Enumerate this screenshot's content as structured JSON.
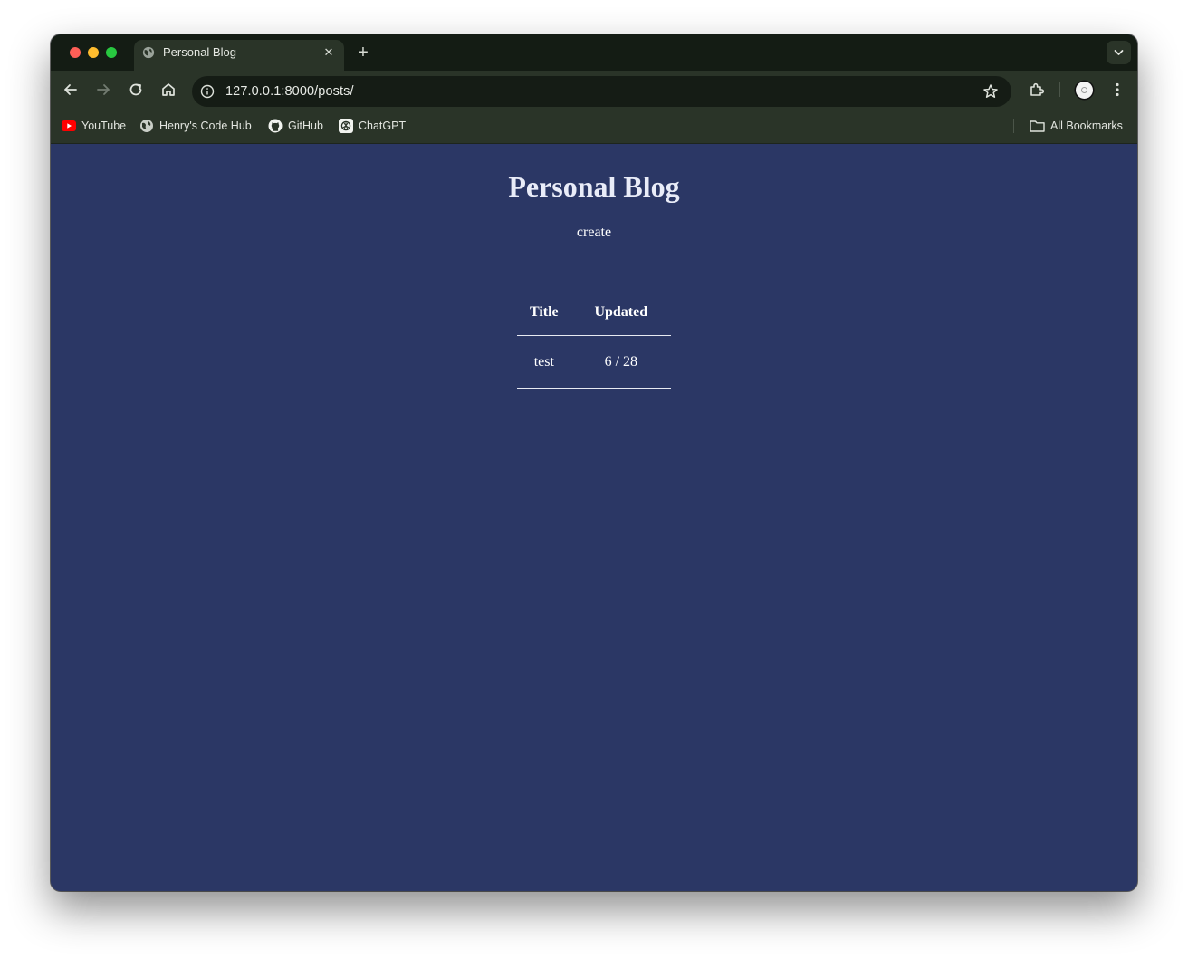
{
  "browser": {
    "tab": {
      "title": "Personal Blog"
    },
    "address_bar": {
      "url": "127.0.0.1:8000/posts/"
    },
    "bookmarks": [
      {
        "label": "YouTube",
        "icon": "youtube-icon"
      },
      {
        "label": "Henry's Code Hub",
        "icon": "globe-icon"
      },
      {
        "label": "GitHub",
        "icon": "github-icon"
      },
      {
        "label": "ChatGPT",
        "icon": "chatgpt-icon"
      }
    ],
    "all_bookmarks_label": "All Bookmarks"
  },
  "page": {
    "title": "Personal Blog",
    "create_link": "create",
    "table": {
      "headers": [
        "Title",
        "Updated"
      ],
      "rows": [
        {
          "title": "test",
          "updated": "6 / 28"
        }
      ]
    }
  },
  "colors": {
    "page_background": "#2b3765",
    "chrome_frame": "#141c14",
    "chrome_toolbar": "#2a3428"
  }
}
